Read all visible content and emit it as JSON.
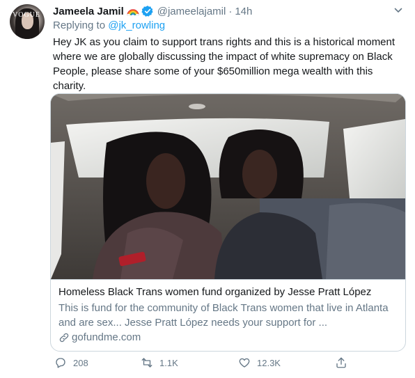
{
  "tweet": {
    "author_name": "Jameela Jamil",
    "handle": "@jameelajamil",
    "separator": "·",
    "time": "14h",
    "replying_prefix": "Replying to ",
    "replying_to": "@jk_rowling",
    "text": "Hey JK as you claim to support trans rights and this is a historical moment where we are globally discussing the impact of white supremacy on Black People, please share some of your $650million mega wealth with this charity.",
    "avatar_text": "VOGUE"
  },
  "card": {
    "title": "Homeless Black Trans women fund organized by Jesse Pratt López",
    "description": "This is fund for the community of Black Trans women that live in Atlanta and are sex... Jesse Pratt López needs your support for ...",
    "domain": "gofundme.com"
  },
  "actions": {
    "replies": "208",
    "retweets": "1.1K",
    "likes": "12.3K"
  },
  "colors": {
    "link": "#1da1f2",
    "secondary_text": "#657786",
    "verified": "#1da1f2"
  }
}
